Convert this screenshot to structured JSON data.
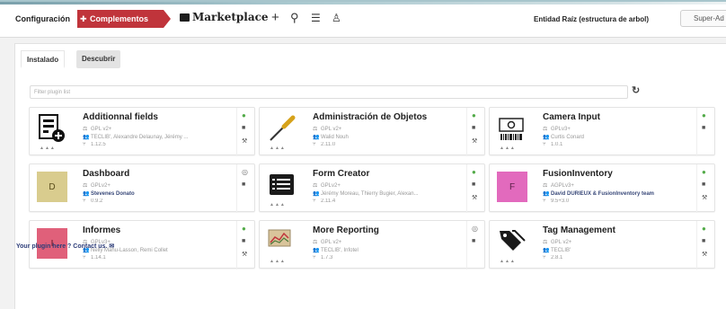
{
  "header": {
    "breadcrumb_config": "Configuración",
    "breadcrumb_plugins": "Complementos",
    "breadcrumb_marketplace": "Marketplace",
    "entity": "Entidad Raíz (estructura de arbol)",
    "profile": "Super-Ad"
  },
  "tabs": {
    "installed": "Instalado",
    "discover": "Descubrir"
  },
  "filter": {
    "placeholder": "Filter plugin list"
  },
  "plugins": [
    {
      "name": "Additionnal fields",
      "license": "GPL v2+",
      "authors": "TECLIB', Alexandre Delaunay, Jérémy ...",
      "version": "1.12.5",
      "state": "on",
      "tile_color": ""
    },
    {
      "name": "Administración de Objetos",
      "license": "GPL v2+",
      "authors": "Walid Nouh",
      "version": "2.11.0",
      "state": "on",
      "tile_color": ""
    },
    {
      "name": "Camera Input",
      "license": "GPLv3+",
      "authors": "Curtis Conard",
      "version": "1.0.1",
      "state": "on",
      "tile_color": ""
    },
    {
      "name": "Dashboard",
      "license": "GPLv2+",
      "authors": "Stevenes Donato",
      "version": "0.9.2",
      "state": "off",
      "tile_color": "#d9cc8e",
      "tile_letter": "D"
    },
    {
      "name": "Form Creator",
      "license": "GPLv2+",
      "authors": "Jérémy Moreau, Thierry Bugier, Alexan...",
      "version": "2.11.4",
      "state": "on",
      "tile_color": ""
    },
    {
      "name": "FusionInventory",
      "license": "AGPLv3+",
      "authors": "David DURIEUX & FusionInventory team",
      "version": "9.5+3.0",
      "state": "on",
      "tile_color": "#e26abd",
      "tile_letter": "F"
    },
    {
      "name": "Informes",
      "license": "GPLv3+",
      "authors": "Nelly Mahu-Lasson, Remi Collet",
      "version": "1.14.1",
      "state": "on",
      "tile_color": "#e0607a",
      "tile_letter": "I"
    },
    {
      "name": "More Reporting",
      "license": "GPL v2+",
      "authors": "TECLIB', Infotel",
      "version": "1.7.3",
      "state": "off",
      "tile_color": ""
    },
    {
      "name": "Tag Management",
      "license": "GPL v2+",
      "authors": "TECLIB'",
      "version": "2.8.1",
      "state": "on",
      "tile_color": ""
    }
  ],
  "footer": {
    "contact": "Your plugin here ? Contact us."
  },
  "colors": {
    "accent": "#c0343b",
    "enabled": "#53ab49"
  }
}
